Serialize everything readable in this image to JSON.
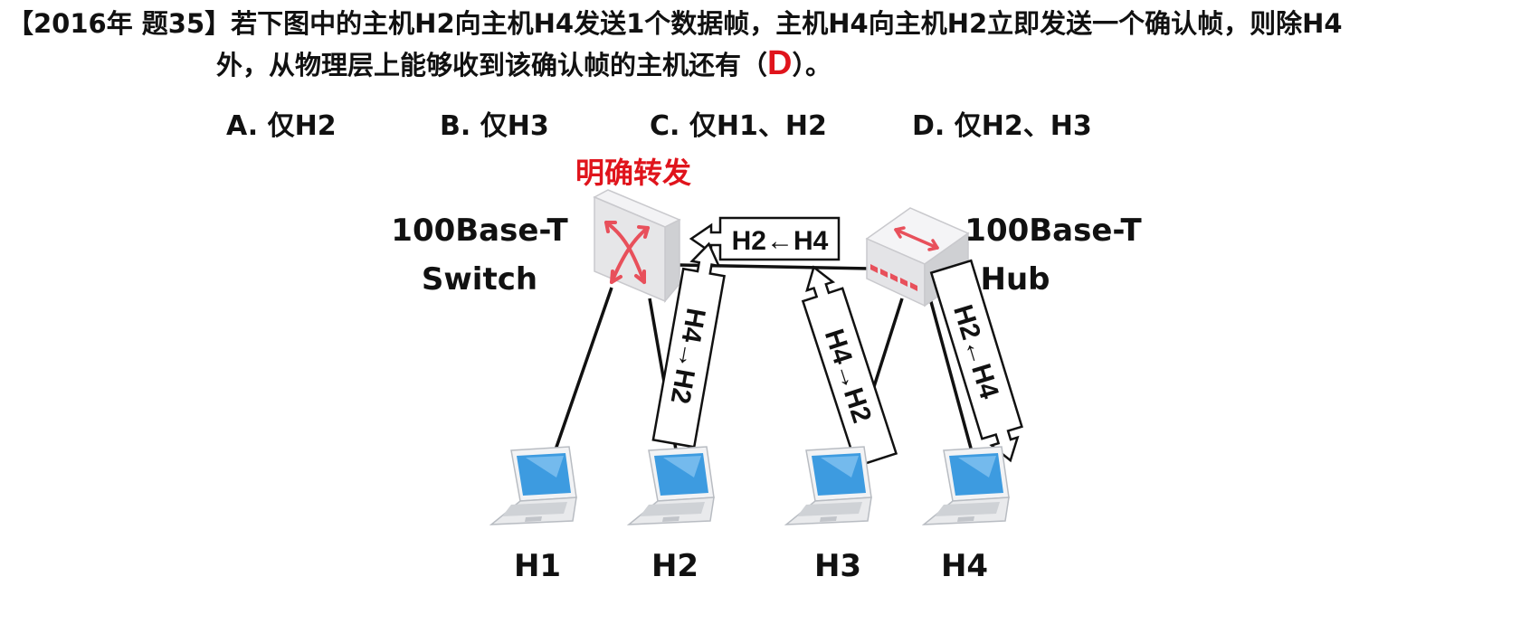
{
  "question": {
    "tag": "【2016年 题35】",
    "line1_text": "若下图中的主机H2向主机H4发送1个数据帧，主机H4向主机H2立即发送一个确认帧，则除H4",
    "line2_prefix": "外，从物理层上能够收到该确认帧的主机还有（",
    "answer": "D",
    "line2_suffix": "）。"
  },
  "options": [
    {
      "label": "A. 仅H2"
    },
    {
      "label": "B. 仅H3"
    },
    {
      "label": "C. 仅H1、H2"
    },
    {
      "label": "D. 仅H2、H3"
    }
  ],
  "diagram": {
    "switch_annotation": "明确转发",
    "switch_label_line1": "100Base-T",
    "switch_label_line2": "Switch",
    "hub_label_line1": "100Base-T",
    "hub_label_line2": "Hub",
    "arrow_hub_to_switch": "H2←H4",
    "arrow_switch_to_h2": "H4→H2",
    "arrow_hub_to_h3": "H4→H2",
    "arrow_h4_to_hub": "H2←H4",
    "hosts": [
      {
        "name": "H1"
      },
      {
        "name": "H2"
      },
      {
        "name": "H3"
      },
      {
        "name": "H4"
      }
    ]
  },
  "colors": {
    "answer_red": "#e0141c",
    "annotation_red": "#e0141c",
    "device_gray": "#e6e6e8",
    "laptop_screen_blue": "#3d9be0",
    "arrow_icon_red": "#e8505b"
  }
}
